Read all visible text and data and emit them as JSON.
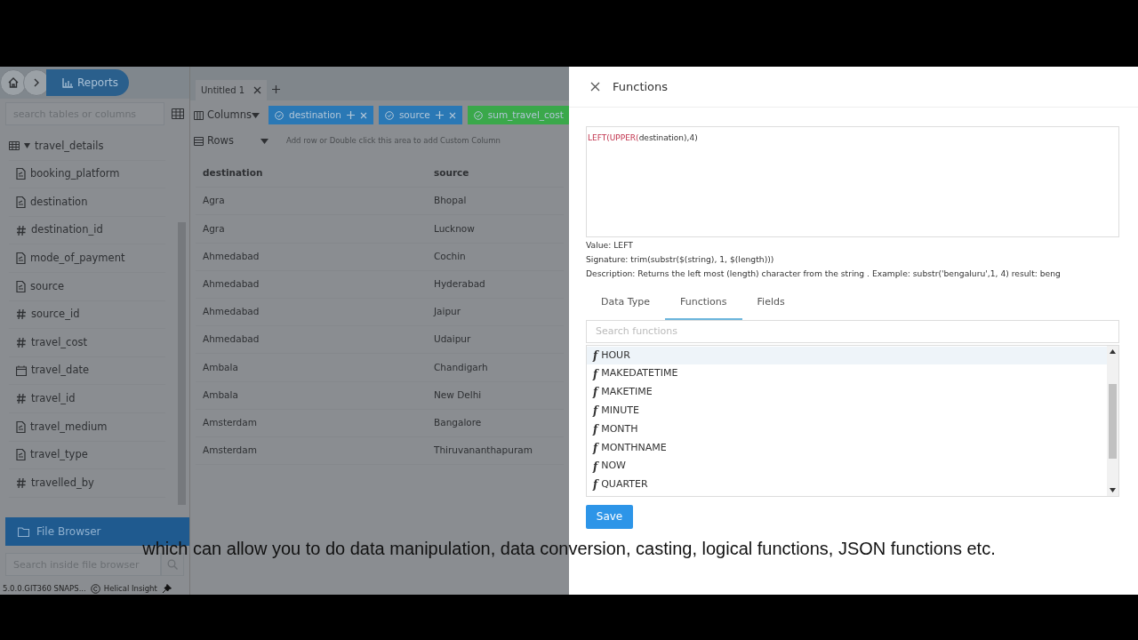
{
  "breadcrumb": {
    "items": [
      {
        "kind": "home"
      },
      {
        "kind": "chevron"
      },
      {
        "kind": "reports",
        "label": "Reports"
      }
    ]
  },
  "sidebar": {
    "search": {
      "placeholder": "search tables or columns"
    },
    "tree": [
      {
        "label": "travel_details",
        "kind": "table",
        "expanded": true,
        "children": [
          {
            "label": "booking_platform",
            "kind": "text"
          },
          {
            "label": "destination",
            "kind": "text"
          },
          {
            "label": "destination_id",
            "kind": "number"
          },
          {
            "label": "mode_of_payment",
            "kind": "text"
          },
          {
            "label": "source",
            "kind": "text"
          },
          {
            "label": "source_id",
            "kind": "number"
          },
          {
            "label": "travel_cost",
            "kind": "number"
          },
          {
            "label": "travel_date",
            "kind": "date"
          },
          {
            "label": "travel_id",
            "kind": "number"
          },
          {
            "label": "travel_medium",
            "kind": "text"
          },
          {
            "label": "travel_type",
            "kind": "text"
          },
          {
            "label": "travelled_by",
            "kind": "number"
          }
        ]
      }
    ],
    "file_browser": {
      "label": "File Browser",
      "search": {
        "placeholder": "Search inside file browser"
      }
    },
    "footer": {
      "version": "5.0.0.GIT360 SNAPS...",
      "brand": "Helical Insight"
    }
  },
  "report": {
    "tabs": [
      {
        "label": "Untitled 1",
        "selected": true
      }
    ],
    "columns_shelf": {
      "label": "Columns",
      "chips": [
        {
          "label": "destination",
          "color": "#2a78b5",
          "icons_visible": true
        },
        {
          "label": "source",
          "color": "#2a78b5",
          "icons_visible": true
        },
        {
          "label": "sum_travel_cost",
          "color": "#3aa84a",
          "icons_visible": false
        }
      ]
    },
    "rows_shelf": {
      "label": "Rows",
      "hint": "Add row or Double click this area to add Custom Column"
    },
    "table": {
      "columns": [
        "destination",
        "source"
      ],
      "rows": [
        [
          "Agra",
          "Bhopal"
        ],
        [
          "Agra",
          "Lucknow"
        ],
        [
          "Ahmedabad",
          "Cochin"
        ],
        [
          "Ahmedabad",
          "Hyderabad"
        ],
        [
          "Ahmedabad",
          "Jaipur"
        ],
        [
          "Ahmedabad",
          "Udaipur"
        ],
        [
          "Ambala",
          "Chandigarh"
        ],
        [
          "Ambala",
          "New Delhi"
        ],
        [
          "Amsterdam",
          "Bangalore"
        ],
        [
          "Amsterdam",
          "Thiruvananthapuram"
        ]
      ]
    }
  },
  "functions_panel": {
    "title": "Functions",
    "expression": [
      {
        "text": "LEFT(",
        "kind": "function"
      },
      {
        "text": "UPPER(",
        "kind": "function"
      },
      {
        "text": "destination),4)",
        "kind": "plain"
      }
    ],
    "info": [
      "Value: LEFT",
      "Signature: trim(substr($(string), 1, $(length)))",
      "Description: Returns the left most (length) character from the string . Example: substr('bengaluru',1, 4) result: beng"
    ],
    "tabs": [
      {
        "label": "Data Type",
        "selected": false
      },
      {
        "label": "Functions",
        "selected": true
      },
      {
        "label": "Fields",
        "selected": false
      }
    ],
    "search": {
      "placeholder": "Search functions"
    },
    "functions": [
      {
        "icon": "f",
        "name": "HOUR",
        "selected": true
      },
      {
        "icon": "f",
        "name": "MAKEDATETIME",
        "selected": false
      },
      {
        "icon": "f",
        "name": "MAKETIME",
        "selected": false
      },
      {
        "icon": "f",
        "name": "MINUTE",
        "selected": false
      },
      {
        "icon": "f",
        "name": "MONTH",
        "selected": false
      },
      {
        "icon": "f",
        "name": "MONTHNAME",
        "selected": false
      },
      {
        "icon": "f",
        "name": "NOW",
        "selected": false
      },
      {
        "icon": "f",
        "name": "QUARTER",
        "selected": false
      }
    ],
    "save_button": "Save"
  },
  "caption": "which can allow you to do data manipulation, data conversion, casting, logical functions, JSON functions etc."
}
